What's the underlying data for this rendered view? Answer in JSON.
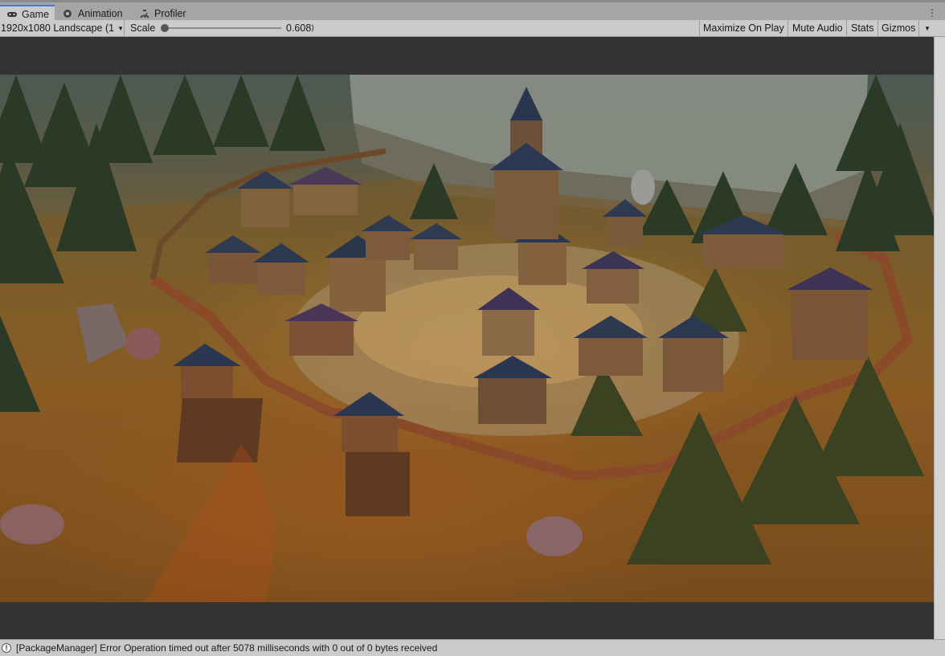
{
  "tabs": [
    {
      "label": "Game",
      "icon": "gamepad-icon",
      "active": true
    },
    {
      "label": "Animation",
      "icon": "animation-icon",
      "active": false
    },
    {
      "label": "Profiler",
      "icon": "profiler-icon",
      "active": false
    }
  ],
  "toolbar": {
    "resolution": "1920x1080 Landscape (1",
    "scale_label": "Scale",
    "scale_value": "0.608",
    "maximize_on_play": "Maximize On Play",
    "mute_audio": "Mute Audio",
    "stats": "Stats",
    "gizmos": "Gizmos"
  },
  "status": {
    "message": "[PackageManager] Error Operation timed out after 5078 milliseconds with 0 out of 0 bytes received"
  },
  "colors": {
    "accent": "#3a79d8",
    "game_background": "#333333"
  }
}
